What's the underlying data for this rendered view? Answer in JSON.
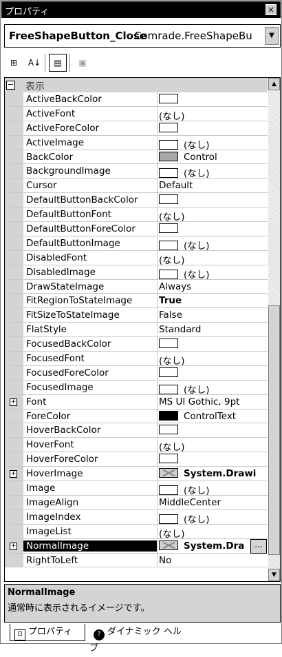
{
  "window": {
    "title": "プロパティ",
    "close_label": "×"
  },
  "object_selector": {
    "name": "FreeShapeButton_Close",
    "type": "Comrade.FreeShapeBu",
    "dropdown_glyph": "▼"
  },
  "toolbar": {
    "categorized_glyph": "⊞",
    "alphabetical_glyph": "A↓",
    "properties_glyph": "▤",
    "events_glyph": "▣"
  },
  "category": {
    "toggle": "−",
    "label": "表示"
  },
  "scrollbar": {
    "up_glyph": "▲",
    "down_glyph": "▼"
  },
  "properties": [
    {
      "name": "ActiveBackColor",
      "swatch": "white",
      "value": ""
    },
    {
      "name": "ActiveFont",
      "value": "(なし)"
    },
    {
      "name": "ActiveForeColor",
      "swatch": "white",
      "value": ""
    },
    {
      "name": "ActiveImage",
      "swatch": "white",
      "value": "(なし)"
    },
    {
      "name": "BackColor",
      "swatch": "gray",
      "value": "Control"
    },
    {
      "name": "BackgroundImage",
      "swatch": "white",
      "value": "(なし)"
    },
    {
      "name": "Cursor",
      "value": "Default"
    },
    {
      "name": "DefaultButtonBackColor",
      "swatch": "white",
      "value": ""
    },
    {
      "name": "DefaultButtonFont",
      "value": "(なし)"
    },
    {
      "name": "DefaultButtonForeColor",
      "swatch": "white",
      "value": ""
    },
    {
      "name": "DefaultButtonImage",
      "swatch": "white",
      "value": "(なし)"
    },
    {
      "name": "DisabledFont",
      "value": "(なし)"
    },
    {
      "name": "DisabledImage",
      "swatch": "white",
      "value": "(なし)"
    },
    {
      "name": "DrawStateImage",
      "value": "Always"
    },
    {
      "name": "FitRegionToStateImage",
      "value": "True",
      "bold": true
    },
    {
      "name": "FitSizeToStateImage",
      "value": "False"
    },
    {
      "name": "FlatStyle",
      "value": "Standard"
    },
    {
      "name": "FocusedBackColor",
      "swatch": "white",
      "value": ""
    },
    {
      "name": "FocusedFont",
      "value": "(なし)"
    },
    {
      "name": "FocusedForeColor",
      "swatch": "white",
      "value": ""
    },
    {
      "name": "FocusedImage",
      "swatch": "white",
      "value": "(なし)"
    },
    {
      "name": "Font",
      "expandable": true,
      "value": "MS UI Gothic, 9pt"
    },
    {
      "name": "ForeColor",
      "swatch": "black",
      "value": "ControlText"
    },
    {
      "name": "HoverBackColor",
      "swatch": "white",
      "value": ""
    },
    {
      "name": "HoverFont",
      "value": "(なし)"
    },
    {
      "name": "HoverForeColor",
      "swatch": "white",
      "value": ""
    },
    {
      "name": "HoverImage",
      "expandable": true,
      "swatch": "img",
      "value": "System.Drawi",
      "bold": true
    },
    {
      "name": "Image",
      "swatch": "white",
      "value": "(なし)"
    },
    {
      "name": "ImageAlign",
      "value": "MiddleCenter"
    },
    {
      "name": "ImageIndex",
      "swatch": "white",
      "value": "(なし)"
    },
    {
      "name": "ImageList",
      "value": "(なし)"
    },
    {
      "name": "NormalImage",
      "expandable": true,
      "swatch": "img",
      "value": "System.Dra",
      "bold": true,
      "selected": true,
      "ellipsis": "..."
    },
    {
      "name": "RightToLeft",
      "value": "No"
    }
  ],
  "description": {
    "title": "NormalImage",
    "text": "通常時に表示されるイメージです。"
  },
  "tabs": [
    {
      "label": "プロパティ",
      "icon": "⊡"
    },
    {
      "label": "ダイナミック ヘルプ",
      "icon": "?"
    }
  ],
  "colors": {
    "selection": "#000000",
    "gutter": "#d4d4d4",
    "grid_line": "#c8c8c8"
  }
}
